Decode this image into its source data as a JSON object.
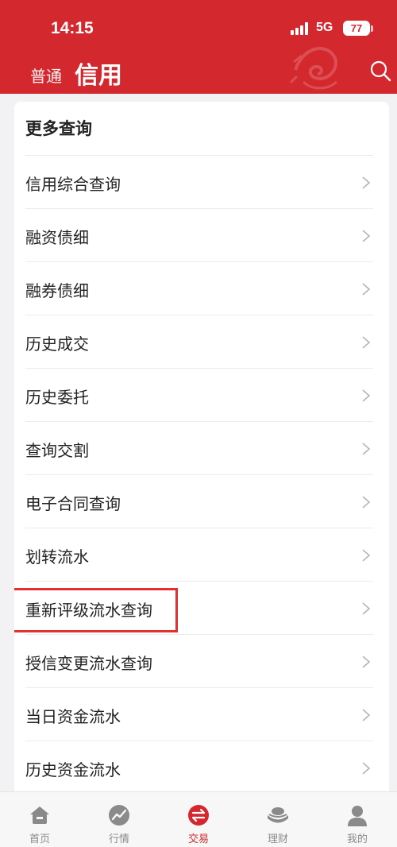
{
  "status_bar": {
    "time": "14:15",
    "network": "5G",
    "battery": "77"
  },
  "header": {
    "tab_normal": "普通",
    "tab_credit": "信用"
  },
  "section": {
    "title": "更多查询",
    "items": [
      {
        "label": "信用综合查询"
      },
      {
        "label": "融资债细"
      },
      {
        "label": "融券债细"
      },
      {
        "label": "历史成交"
      },
      {
        "label": "历史委托"
      },
      {
        "label": "查询交割"
      },
      {
        "label": "电子合同查询"
      },
      {
        "label": "划转流水"
      },
      {
        "label": "重新评级流水查询"
      },
      {
        "label": "授信变更流水查询"
      },
      {
        "label": "当日资金流水"
      },
      {
        "label": "历史资金流水"
      }
    ]
  },
  "bottom_nav": [
    {
      "label": "首页",
      "icon": "home-icon"
    },
    {
      "label": "行情",
      "icon": "market-icon"
    },
    {
      "label": "交易",
      "icon": "trade-icon",
      "active": true
    },
    {
      "label": "理财",
      "icon": "wealth-icon"
    },
    {
      "label": "我的",
      "icon": "profile-icon"
    }
  ],
  "colors": {
    "brand": "#d3282e",
    "highlight": "#e0322f",
    "inactive": "#8a8a8a"
  }
}
